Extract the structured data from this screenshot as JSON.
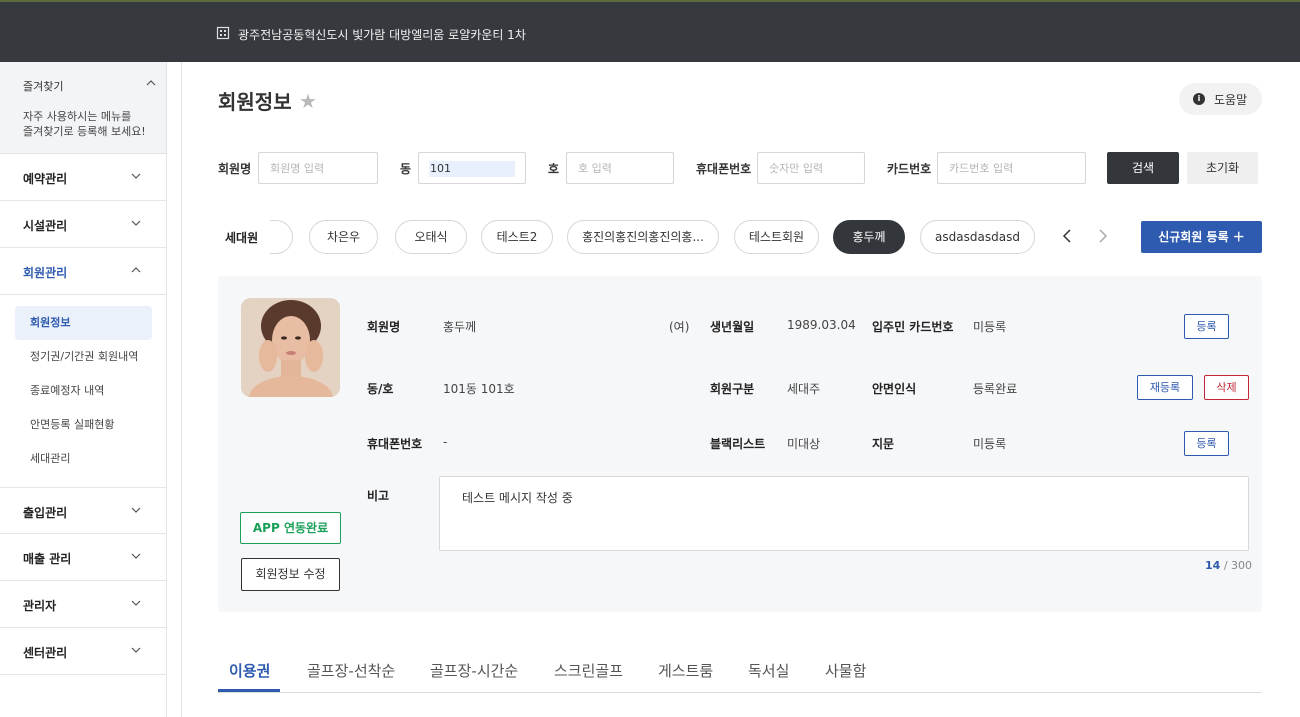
{
  "topbar": {
    "title": "광주전남공동혁신도시 빛가람 대방엘리움 로얄카운티 1차",
    "icon": "building-icon"
  },
  "sidebar": {
    "favorites": {
      "title": "즐겨찾기",
      "desc_line1": "자주 사용하시는 메뉴를",
      "desc_line2": "즐겨찾기로 등록해 보세요!"
    },
    "menus": [
      {
        "label": "예약관리"
      },
      {
        "label": "시설관리"
      },
      {
        "label": "회원관리"
      },
      {
        "label": "출입관리"
      },
      {
        "label": "매출 관리"
      },
      {
        "label": "관리자"
      },
      {
        "label": "센터관리"
      }
    ],
    "submenu": [
      {
        "label": "회원정보"
      },
      {
        "label": "정기권/기간권 회원내역"
      },
      {
        "label": "종료예정자 내역"
      },
      {
        "label": "안면등록 실패현황"
      },
      {
        "label": "세대관리"
      }
    ]
  },
  "header": {
    "title": "회원정보",
    "help": "도움말"
  },
  "search": {
    "member_label": "회원명",
    "member_placeholder": "회원명 입력",
    "dong_label": "동",
    "dong_value": "101",
    "ho_label": "호",
    "ho_placeholder": "호 입력",
    "phone_label": "휴대폰번호",
    "phone_placeholder": "숫자만 입력",
    "card_label": "카드번호",
    "card_placeholder": "카드번호 입력",
    "search_btn": "검색",
    "reset_btn": "초기화"
  },
  "family": {
    "label": "세대원",
    "members": [
      "차은우",
      "오태식",
      "테스트2",
      "홍진의홍진의홍진의홍...",
      "테스트회원",
      "홍두께",
      "asdasdasdasd"
    ],
    "selected": "홍두께",
    "new_btn": "신규회원 등록 ＋"
  },
  "profile": {
    "name_label": "회원명",
    "name": "홍두께",
    "gender": "(여)",
    "birth_label": "생년월일",
    "birth": "1989.03.04",
    "card_label": "입주민 카드번호",
    "card": "미등록",
    "register_btn": "등록",
    "unit_label": "동/호",
    "unit": "101동 101호",
    "type_label": "회원구분",
    "type": "세대주",
    "face_label": "안면인식",
    "face": "등록완료",
    "reregister_btn": "재등록",
    "delete_btn": "삭제",
    "phone_label": "휴대폰번호",
    "phone": "-",
    "blacklist_label": "블랙리스트",
    "blacklist": "미대상",
    "finger_label": "지문",
    "finger": "미등록",
    "register_btn2": "등록",
    "memo_label": "비고",
    "memo": "테스트 메시지 작성 중",
    "memo_count": "14",
    "memo_max": "/ 300",
    "app_btn": "APP 연동완료",
    "edit_btn": "회원정보 수정"
  },
  "tabs": [
    "이용권",
    "골프장-선착순",
    "골프장-시간순",
    "스크린골프",
    "게스트룸",
    "독서실",
    "사물함"
  ],
  "colors": {
    "primary": "#2e5bb0",
    "dark": "#33373c",
    "danger": "#c0283a",
    "success": "#1aa058"
  }
}
